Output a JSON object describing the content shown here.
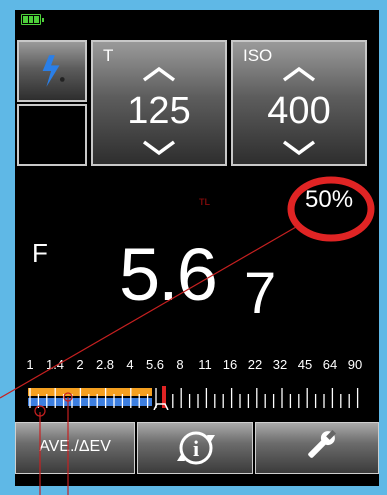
{
  "battery_icon": "battery-full-icon",
  "flash_mode_icon": "flash-icon",
  "shutter": {
    "label": "T",
    "value": "125",
    "up_icon": "chevron-up-icon",
    "down_icon": "chevron-down-icon"
  },
  "iso": {
    "label": "ISO",
    "value": "400",
    "up_icon": "chevron-up-icon",
    "down_icon": "chevron-down-icon"
  },
  "tl_label": "TL",
  "percent": "50%",
  "aperture": {
    "label": "F",
    "value": "5.6",
    "tenths": "7"
  },
  "scale": [
    "1",
    "1.4",
    "2",
    "2.8",
    "4",
    "5.6",
    "8",
    "11",
    "16",
    "22",
    "32",
    "45",
    "64",
    "90"
  ],
  "buttons": {
    "ave_label": "AVE./ΔEV",
    "info_icon": "info-rotate-icon",
    "settings_icon": "wrench-icon"
  },
  "colors": {
    "accent": "#e02424",
    "scale_orange": "#f5a020",
    "scale_blue": "#3d7fe0",
    "battery": "#4ecf3a",
    "background": "#5fb8e6"
  }
}
